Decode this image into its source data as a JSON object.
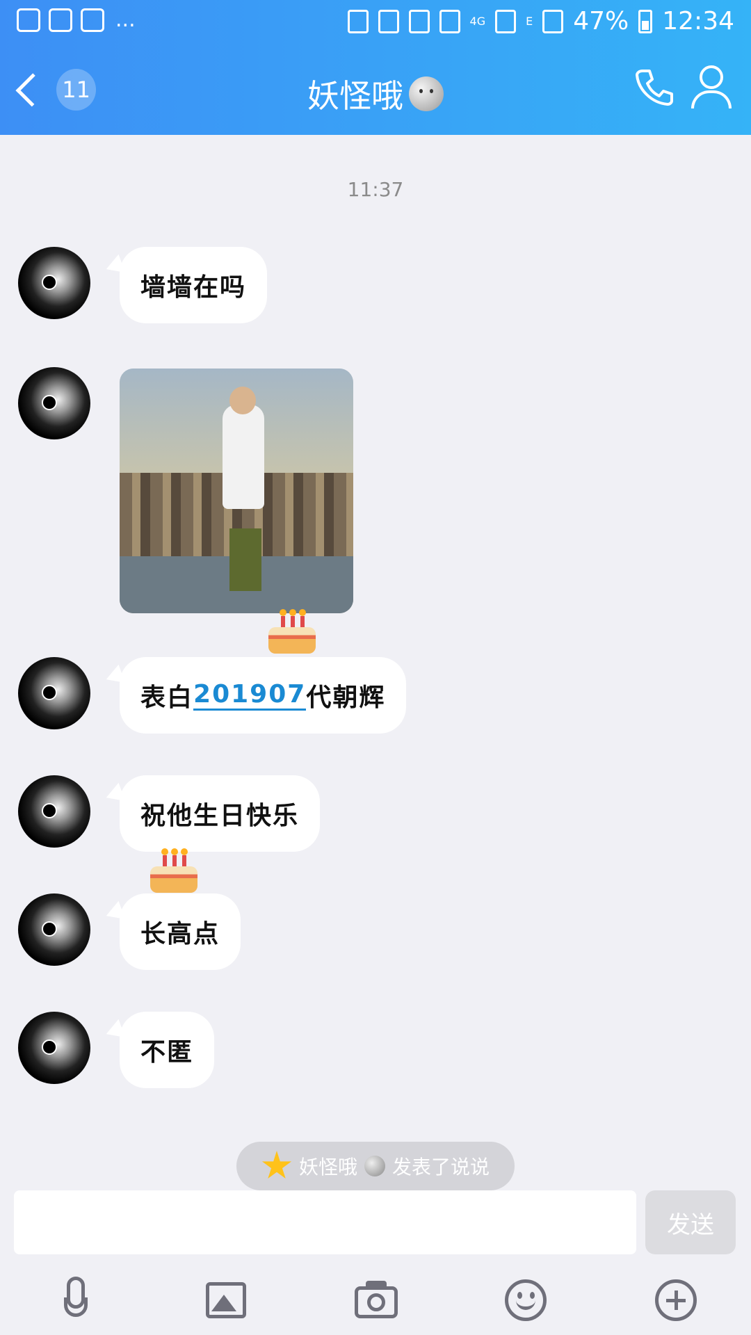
{
  "status_bar": {
    "dots": "...",
    "network_4g": "4G",
    "network_e": "E",
    "battery": "47%",
    "time": "12:34"
  },
  "header": {
    "back_badge": "11",
    "title": "妖怪哦"
  },
  "chat": {
    "timestamp": "11:37",
    "messages": [
      {
        "text": "墙墙在吗"
      },
      {
        "type": "image"
      },
      {
        "prefix": "表白",
        "link": "201907",
        "suffix": "代朝辉"
      },
      {
        "text": "祝他生日快乐"
      },
      {
        "text": "长高点"
      },
      {
        "text": "不匿"
      }
    ]
  },
  "notice": {
    "name": "妖怪哦",
    "text": "发表了说说"
  },
  "input": {
    "placeholder": "",
    "send_label": "发送"
  },
  "toolbar": {
    "icons": [
      "mic-icon",
      "image-icon",
      "camera-icon",
      "emoji-icon",
      "plus-icon"
    ]
  },
  "colors": {
    "header_start": "#3d8ff5",
    "header_end": "#35b3f7",
    "link": "#1a8ad3",
    "background": "#f0f0f5"
  }
}
